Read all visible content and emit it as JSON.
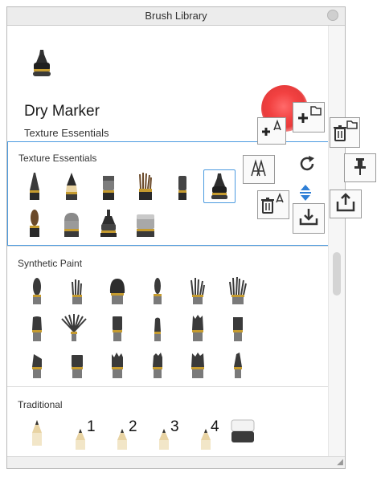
{
  "window": {
    "title": "Brush Library"
  },
  "preview": {
    "brush_name": "Dry Marker",
    "brush_set": "Texture Essentials"
  },
  "categories": [
    {
      "label": "Texture Essentials"
    },
    {
      "label": "Synthetic Paint"
    },
    {
      "label": "Traditional"
    }
  ],
  "traditional_numbers": [
    "1",
    "2",
    "3",
    "4"
  ],
  "colors": {
    "selection": "#4c9be0",
    "preview_stroke": "#e83c3c"
  },
  "floating_tools": [
    "add-brush-icon",
    "add-brush-set-icon",
    "delete-brush-set-icon",
    "duplicate-brush-icon",
    "reset-icon",
    "pin-icon",
    "delete-brush-icon",
    "move-icon",
    "import-icon",
    "export-icon"
  ]
}
